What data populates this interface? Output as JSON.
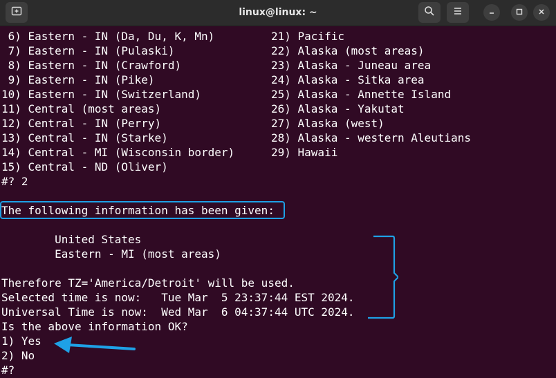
{
  "window": {
    "title": "linux@linux: ~"
  },
  "titlebar": {
    "new_tab_icon": "new-tab-icon",
    "search_icon": "search-icon",
    "menu_icon": "hamburger-menu-icon",
    "minimize_icon": "minimize-icon",
    "maximize_icon": "maximize-icon",
    "close_icon": "close-icon"
  },
  "terminal": {
    "left_column": [
      " 6) Eastern - IN (Da, Du, K, Mn)",
      " 7) Eastern - IN (Pulaski)",
      " 8) Eastern - IN (Crawford)",
      " 9) Eastern - IN (Pike)",
      "10) Eastern - IN (Switzerland)",
      "11) Central (most areas)",
      "12) Central - IN (Perry)",
      "13) Central - IN (Starke)",
      "14) Central - MI (Wisconsin border)",
      "15) Central - ND (Oliver)"
    ],
    "right_column": [
      "21) Pacific",
      "22) Alaska (most areas)",
      "23) Alaska - Juneau area",
      "24) Alaska - Sitka area",
      "25) Alaska - Annette Island",
      "26) Alaska - Yakutat",
      "27) Alaska (west)",
      "28) Alaska - western Aleutians",
      "29) Hawaii"
    ],
    "prompt_answer": "#? 2",
    "info_heading": "The following information has been given:",
    "country": "        United States",
    "zone": "        Eastern - MI (most areas)",
    "tz_line": "Therefore TZ='America/Detroit' will be used.",
    "selected_time": "Selected time is now:   Tue Mar  5 23:37:44 EST 2024.",
    "universal_time": "Universal Time is now:  Wed Mar  6 04:37:44 UTC 2024.",
    "question": "Is the above information OK?",
    "option_yes": "1) Yes",
    "option_no": "2) No",
    "final_prompt": "#?"
  },
  "colors": {
    "terminal_bg": "#300a24",
    "text": "#ffffff",
    "annotation": "#1ea1e6",
    "titlebar_bg": "#2c2c2c"
  }
}
